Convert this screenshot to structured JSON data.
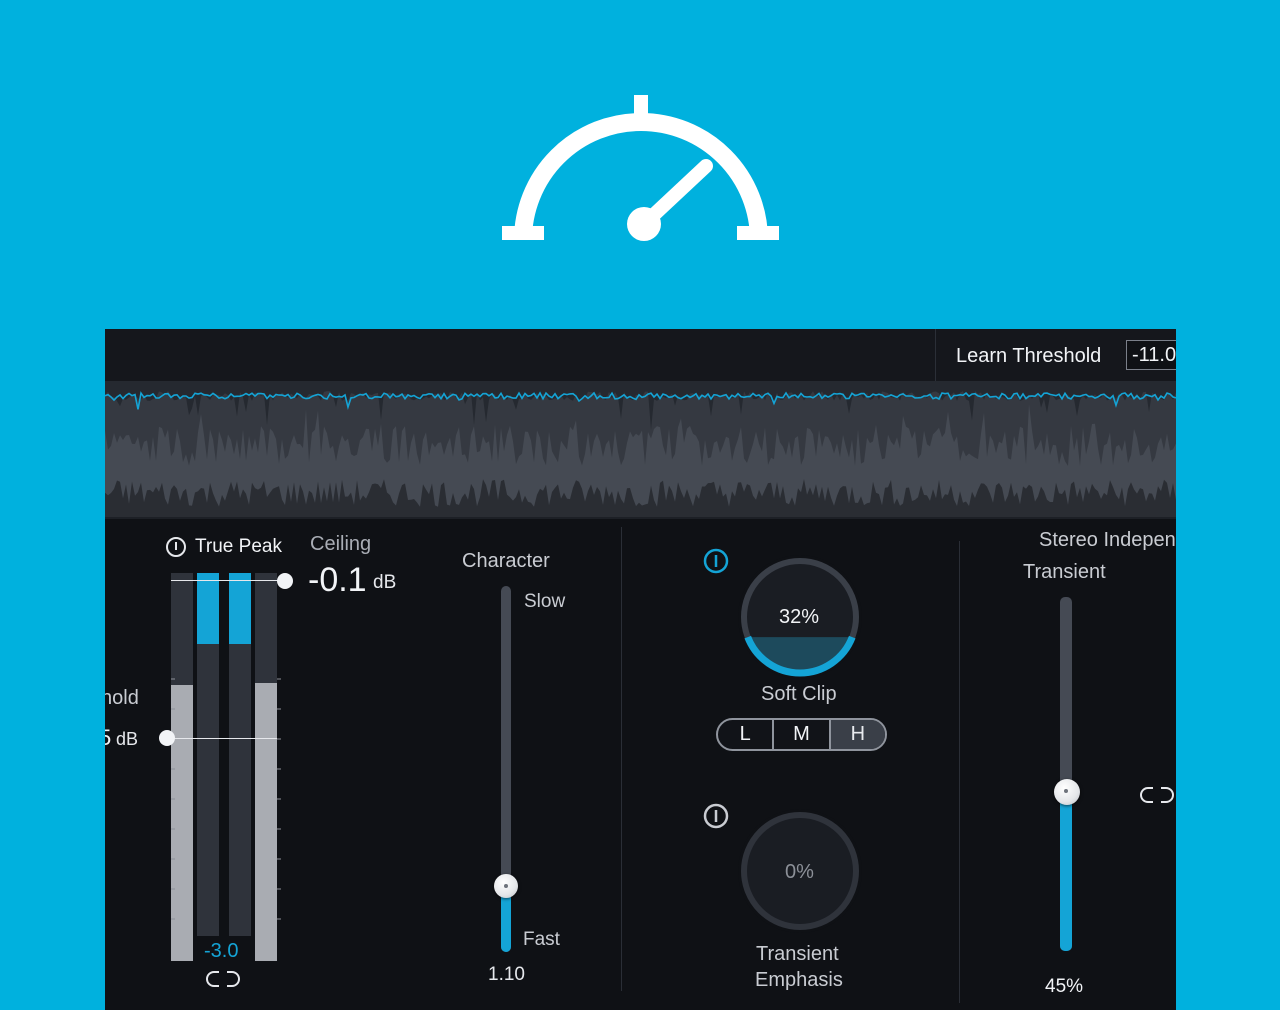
{
  "header": {
    "learn_threshold_label": "Learn Threshold",
    "learn_threshold_value": "-11.0"
  },
  "limiter": {
    "threshold_label": "hold",
    "threshold_unit": "dB",
    "true_peak_label": "True Peak",
    "ceiling_label": "Ceiling",
    "ceiling_value": "-0.1",
    "ceiling_unit": "dB",
    "gain_reduction_readout": "-3.0"
  },
  "character": {
    "label": "Character",
    "top_label": "Slow",
    "bottom_label": "Fast",
    "value": "1.10",
    "fill_fraction": 0.18
  },
  "soft_clip": {
    "label": "Soft Clip",
    "value": "32%",
    "fraction": 0.32,
    "modes": [
      "L",
      "M",
      "H"
    ],
    "selected_mode": "H"
  },
  "transient_emphasis": {
    "label_line1": "Transient",
    "label_line2": "Emphasis",
    "value": "0%"
  },
  "stereo": {
    "header": "Stereo Indepen",
    "transient_label": "Transient",
    "value": "45%",
    "fill_fraction": 0.45
  },
  "colors": {
    "background": "#00b1de",
    "accent": "#14a4d6",
    "panel": "#0f1115"
  }
}
